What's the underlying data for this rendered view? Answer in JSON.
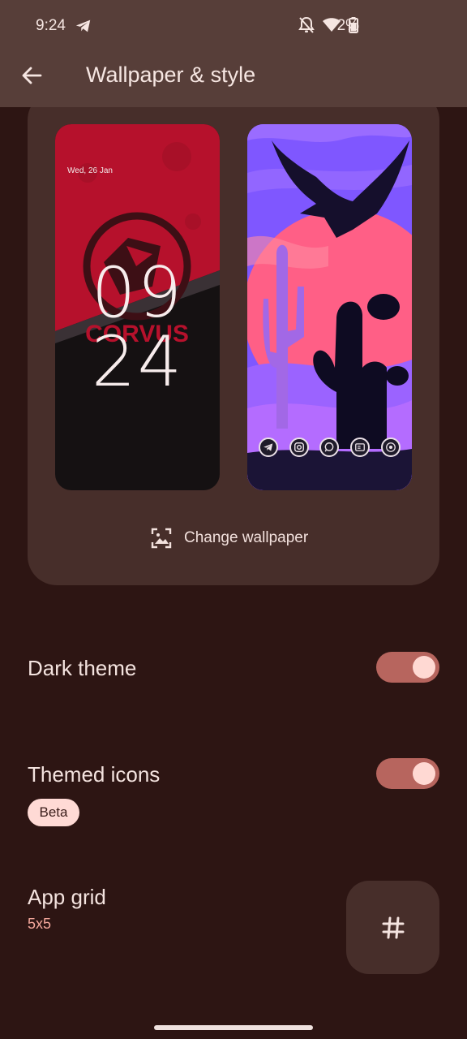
{
  "status_bar": {
    "time": "9:24",
    "battery": "72%",
    "icons": [
      "telegram-icon",
      "bell-off-icon",
      "wifi-icon",
      "battery-icon"
    ]
  },
  "app_bar": {
    "title": "Wallpaper & style",
    "back_icon": "arrow-left-icon"
  },
  "preview": {
    "lock_screen": {
      "date": "Wed, 26 Jan",
      "clock_hours": "09",
      "clock_minutes": "24",
      "logo_text": "CORVUS"
    },
    "home_screen": {
      "dock_icons": [
        "telegram-icon",
        "instagram-icon",
        "whatsapp-icon",
        "news-icon",
        "chrome-icon"
      ]
    },
    "change_wallpaper_label": "Change wallpaper"
  },
  "settings": {
    "dark_theme": {
      "label": "Dark theme",
      "enabled": true
    },
    "themed_icons": {
      "label": "Themed icons",
      "badge": "Beta",
      "enabled": true
    },
    "app_grid": {
      "label": "App grid",
      "value": "5x5"
    }
  },
  "colors": {
    "background": "#2d1513",
    "topbar": "#573e39",
    "card": "#472e2a",
    "toggle_track": "#b7655e",
    "toggle_knob": "#ffd9d3",
    "accent_text": "#f5a89c"
  }
}
